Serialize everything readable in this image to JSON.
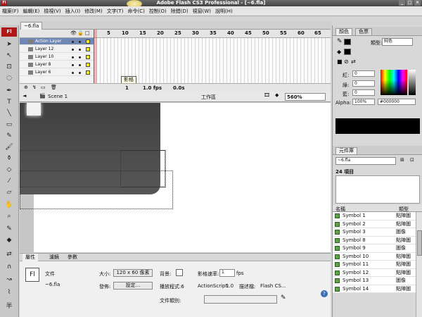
{
  "window": {
    "title": "Adobe Flash CS3 Professional - [~6.fla]",
    "app_logo": "Fl"
  },
  "menu": [
    "檔案(F)",
    "編輯(E)",
    "檢視(V)",
    "插入(I)",
    "修改(M)",
    "文字(T)",
    "命令(C)",
    "控制(O)",
    "除錯(D)",
    "視窗(W)",
    "說明(H)"
  ],
  "document": {
    "tab": "~6.fla"
  },
  "timeline": {
    "frame_numbers": [
      "5",
      "10",
      "15",
      "20",
      "25",
      "30",
      "35",
      "40",
      "45",
      "50",
      "55",
      "60",
      "65"
    ],
    "layers": [
      "Action Layer",
      "Layer 12",
      "Layer 10",
      "Layer 8",
      "Layer 6"
    ],
    "current_frame": "1",
    "fps": "1.0 fps",
    "time": "0.0s",
    "tooltip": "影格"
  },
  "editbar": {
    "scene": "Scene 1",
    "workspace": "工作區",
    "zoom": "560%"
  },
  "properties": {
    "tabs": [
      "屬性",
      "濾鏡",
      "參數"
    ],
    "doc_label": "文件",
    "doc_name": "~6.fla",
    "size_label": "大小:",
    "size_value": "120 x 60 像素",
    "bg_label": "背景:",
    "fps_label": "影格速率:",
    "fps_value": "1",
    "fps_unit": "fps",
    "publish_label": "發佈:",
    "settings_button": "設定...",
    "player_label": "播放程式:6",
    "actionscript_label": "ActionScript:",
    "actionscript_value": "1.0",
    "profile_label": "描述檔:",
    "profile_value": "Flash CS...",
    "doc_class_label": "文件類別:"
  },
  "color_panel": {
    "tabs": [
      "顏色",
      "色票"
    ],
    "type_label": "類型:",
    "type_value": "純色",
    "red_label": "紅:",
    "green_label": "綠:",
    "blue_label": "藍:",
    "red": "0",
    "green": "0",
    "blue": "0",
    "alpha_label": "Alpha:",
    "alpha": "100%",
    "hex": "#000000"
  },
  "library": {
    "tab": "元件庫",
    "doc_select": "~6.fla",
    "count": "24 項目",
    "col_name": "名稱",
    "col_type": "類型",
    "rows": [
      {
        "name": "Symbol 1",
        "type": "點陣圖"
      },
      {
        "name": "Symbol 2",
        "type": "點陣圖"
      },
      {
        "name": "Symbol 3",
        "type": "圖像"
      },
      {
        "name": "Symbol 8",
        "type": "點陣圖"
      },
      {
        "name": "Symbol 9",
        "type": "圖像"
      },
      {
        "name": "Symbol 10",
        "type": "點陣圖"
      },
      {
        "name": "Symbol 11",
        "type": "點陣圖"
      },
      {
        "name": "Symbol 12",
        "type": "點陣圖"
      },
      {
        "name": "Symbol 13",
        "type": "圖像"
      },
      {
        "name": "Symbol 14",
        "type": "點陣圖"
      }
    ]
  }
}
